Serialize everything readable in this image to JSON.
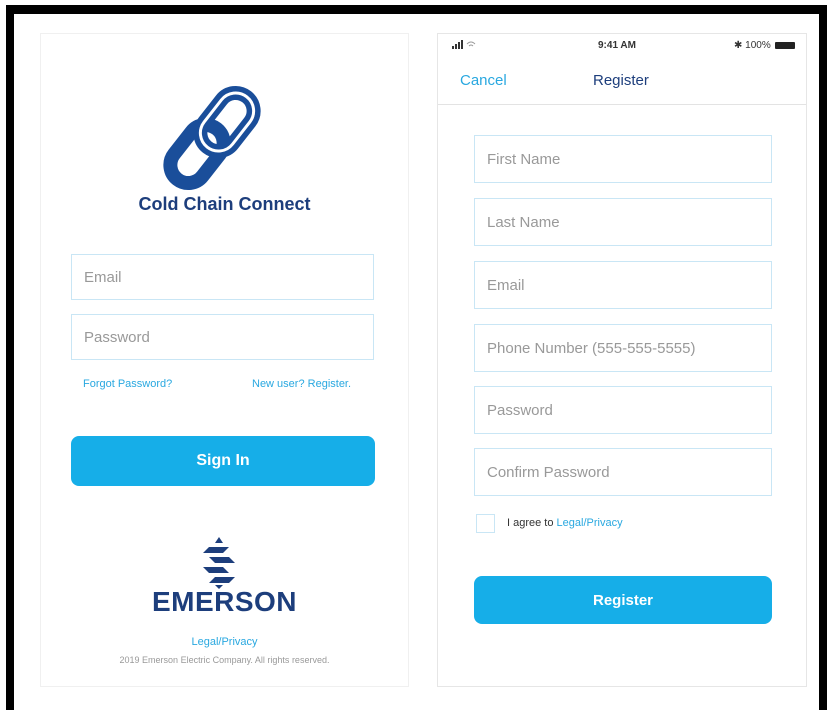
{
  "login": {
    "app_name": "Cold Chain Connect",
    "email_placeholder": "Email",
    "password_placeholder": "Password",
    "forgot_password": "Forgot Password?",
    "new_user": "New user? Register.",
    "sign_in": "Sign In",
    "brand": "EMERSON",
    "legal_privacy": "Legal/Privacy",
    "copyright": "2019 Emerson Electric Company. All rights reserved."
  },
  "register": {
    "status_time": "9:41 AM",
    "status_battery": "100%",
    "cancel": "Cancel",
    "title": "Register",
    "fields": [
      "First Name",
      "Last Name",
      "Email",
      "Phone Number (555-555-5555)",
      "Password",
      "Confirm Password"
    ],
    "agree_text": "I agree to",
    "agree_link": "Legal/Privacy",
    "register_button": "Register"
  },
  "colors": {
    "accent": "#16aee8",
    "brand_navy": "#1d3e7c",
    "link": "#29a8e0",
    "field_border": "#c9e6f5"
  },
  "icons": [
    "chain-link-logo-icon",
    "emerson-logo-icon",
    "signal-icon",
    "wifi-icon",
    "bluetooth-icon",
    "battery-icon"
  ]
}
